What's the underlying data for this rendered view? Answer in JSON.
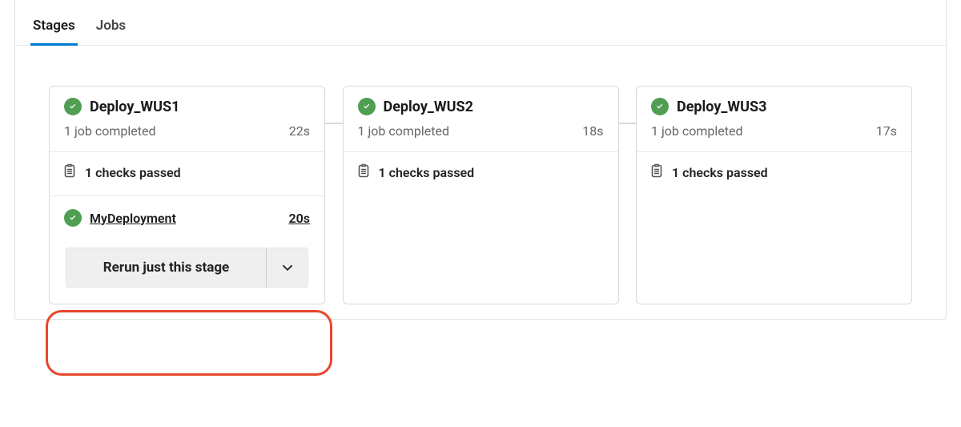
{
  "tabs": {
    "stages": "Stages",
    "jobs": "Jobs"
  },
  "stages": [
    {
      "name": "Deploy_WUS1",
      "status_text": "1 job completed",
      "duration": "22s",
      "checks_text": "1 checks passed",
      "expanded": true,
      "job": {
        "name": "MyDeployment",
        "duration": "20s"
      },
      "rerun_label": "Rerun just this stage"
    },
    {
      "name": "Deploy_WUS2",
      "status_text": "1 job completed",
      "duration": "18s",
      "checks_text": "1 checks passed"
    },
    {
      "name": "Deploy_WUS3",
      "status_text": "1 job completed",
      "duration": "17s",
      "checks_text": "1 checks passed"
    }
  ]
}
